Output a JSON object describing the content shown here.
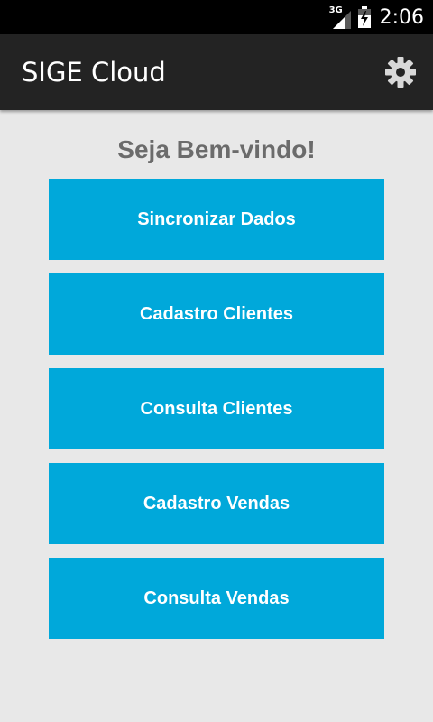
{
  "status_bar": {
    "network_type": "3G",
    "time": "2:06"
  },
  "action_bar": {
    "title": "SIGE Cloud",
    "settings_icon": "gear-icon"
  },
  "main": {
    "welcome": "Seja Bem-vindo!",
    "buttons": [
      {
        "label": "Sincronizar Dados"
      },
      {
        "label": "Cadastro Clientes"
      },
      {
        "label": "Consulta Clientes"
      },
      {
        "label": "Cadastro Vendas"
      },
      {
        "label": "Consulta Vendas"
      }
    ]
  },
  "colors": {
    "accent": "#00a8da",
    "action_bar": "#232323",
    "background": "#e8e8e8",
    "welcome_text": "#6b6b6b"
  }
}
